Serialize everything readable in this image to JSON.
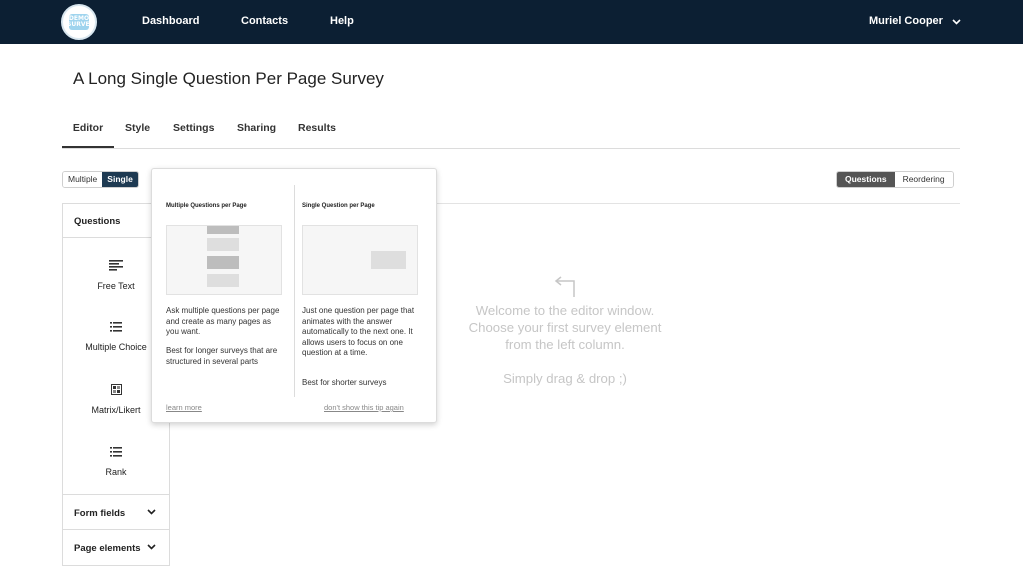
{
  "nav": {
    "logo_text": "DEMO\nSURVEY",
    "items": [
      "Dashboard",
      "Contacts",
      "Help"
    ],
    "user_name": "Muriel Cooper"
  },
  "page": {
    "title": "A Long Single Question Per Page Survey"
  },
  "tabs": [
    "Editor",
    "Style",
    "Settings",
    "Sharing",
    "Results"
  ],
  "active_tab": "Editor",
  "mode_toggle": {
    "options": [
      "Multiple",
      "Single"
    ],
    "selected": "Single"
  },
  "view_toggle": {
    "options": [
      "Questions",
      "Reordering"
    ],
    "selected": "Questions"
  },
  "sidebar": {
    "questions_label": "Questions",
    "elements": [
      {
        "label": "Free Text",
        "icon": "free-text-icon"
      },
      {
        "label": "Multiple Choice",
        "icon": "list-icon"
      },
      {
        "label": "Matrix/Likert",
        "icon": "matrix-icon"
      },
      {
        "label": "Rank",
        "icon": "rank-icon"
      }
    ],
    "form_fields_label": "Form fields",
    "page_elements_label": "Page elements"
  },
  "popover": {
    "multiple": {
      "title": "Multiple Questions per Page",
      "desc1": "Ask multiple questions per page and create as many pages as you want.",
      "desc2": "Best for longer surveys that are structured in several parts",
      "link": "learn more"
    },
    "single": {
      "title": "Single Question per Page",
      "desc1": "Just one question per page that animates with the answer automatically to the next one. It allows users to focus on one question at a time.",
      "desc2": "Best for shorter surveys",
      "link": "don't show this tip again"
    }
  },
  "welcome": {
    "line1": "Welcome to the editor window.",
    "line2": "Choose your first survey element",
    "line3": "from the left column.",
    "sub": "Simply drag & drop ;)"
  },
  "colors": {
    "topbar": "#0c1f33",
    "toggle_on": "#1e3a52",
    "welcome_text": "#c6c6c6"
  }
}
